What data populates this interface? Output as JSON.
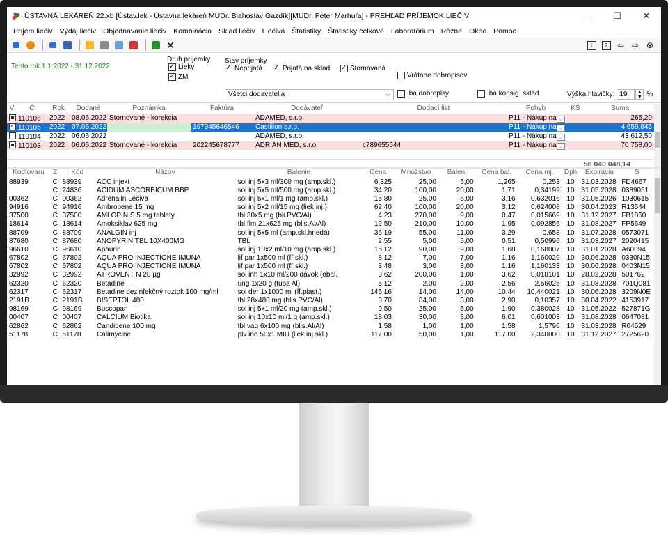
{
  "window": {
    "title": "ÚSTAVNÁ LEKÁREŇ 22.xb [Ústav.lek - Ústavna lekáreň MUDr. Blahoslav Gazdík][MUDr. Peter Marhuľa] - PREHĽAD PRÍJEMOK LIEČIV",
    "minimize": "—",
    "maximize": "☐",
    "close": "✕"
  },
  "menu": [
    "Príjem liečiv",
    "Výdaj liečiv",
    "Objednávanie liečiv",
    "Kombinácia",
    "Sklad liečiv",
    "Liečivá",
    "Štatistiky",
    "Štatistiky celkové",
    "Laboratórium",
    "Rôzne",
    "Okno",
    "Pomoc"
  ],
  "toolbar": {
    "close_glyph": "✕",
    "right_glyphs": [
      "i",
      "?",
      "⇦",
      "⇨",
      "⊗"
    ]
  },
  "filters": {
    "period": "Tento rok  1.1.2022 - 31.12.2022",
    "druh_title": "Druh príjemky",
    "druh_lieky": "Lieky",
    "druh_zm": "ZM",
    "stav_title": "Stav príjemky",
    "stav_neprijata": "Neprijatá",
    "stav_prijata": "Prijatá na sklad",
    "stav_stornovana": "Stornovaná",
    "vratane": "Vrátane dobropisov",
    "iba_dobropisy": "Iba dobropisy",
    "iba_konsig": "Iba konsig. sklad",
    "dodavatel_select": "Všetci dodavatelia",
    "vyska_label": "Výška hlavičky:",
    "vyska_value": "19",
    "vyska_unit": "%"
  },
  "upper_table": {
    "headers": [
      "V",
      "Č",
      "Rok",
      "Dodané",
      "Poznámka",
      "Faktúra",
      "Dodávateľ",
      "Dodací list",
      "Pohyb",
      "KS",
      "Suma"
    ],
    "rows": [
      {
        "c": "110106",
        "rok": "2022",
        "dodane": "08.06.2022",
        "poznamka": "Stornované - korekcia",
        "faktura": "",
        "dodavatel": "ADAMED, s.r.o.",
        "dodaci": "",
        "pohyb": "P11 - Nákup na",
        "ks": "",
        "suma": "265,20",
        "style": "pink",
        "mark": "fill"
      },
      {
        "c": "110105",
        "rok": "2022",
        "dodane": "07.06.2022",
        "poznamka": "",
        "faktura": "197945646546",
        "dodavatel": "Castilion s.r.o.",
        "dodaci": "",
        "pohyb": "P11 - Nákup na",
        "ks": "",
        "suma": "4 659,845",
        "style": "sel",
        "mark": "check"
      },
      {
        "c": "110104",
        "rok": "2022",
        "dodane": "06.06.2022",
        "poznamka": "",
        "faktura": "",
        "dodavatel": "ADAMED, s.r.o.",
        "dodaci": "",
        "pohyb": "P11 - Nákup na",
        "ks": "",
        "suma": "43 612,50",
        "style": "white",
        "mark": "empty"
      },
      {
        "c": "110103",
        "rok": "2022",
        "dodane": "06.06.2022",
        "poznamka": "Stornované - korekcia",
        "faktura": "202245678777",
        "dodavatel": "ADRIAN MED, s.r.o.",
        "dodaci": "c789655544",
        "pohyb": "P11 - Nákup na",
        "ks": "",
        "suma": "70 758,00",
        "style": "pink",
        "mark": "fill"
      }
    ],
    "total": "56 040 048,14"
  },
  "lower_table": {
    "headers": [
      "Kodtovaru",
      "Z",
      "Kód",
      "Názov",
      "Balenie",
      "Cena",
      "Množstvo",
      "Balení",
      "Cena bal.",
      "Cena mj.",
      "Dph",
      "Expirácia",
      "Š"
    ],
    "rows": [
      [
        "88939",
        "C",
        "88939",
        "ACC injekt",
        "sol inj 5x3 ml/300 mg (amp.skl.)",
        "6,325",
        "25,00",
        "5,00",
        "1,265",
        "0,253",
        "10",
        "31.03.2028",
        "FD4667"
      ],
      [
        "",
        "C",
        "24836",
        "ACIDUM ASCORBICUM BBP",
        "sol inj 5x5 ml/500 mg (amp.skl.)",
        "34,20",
        "100,00",
        "20,00",
        "1,71",
        "0,34199",
        "10",
        "31.05.2028",
        "0389051"
      ],
      [
        "00362",
        "C",
        "00362",
        "Adrenalin Léčiva",
        "sol inj 5x1 ml/1 mg (amp.skl.)",
        "15,80",
        "25,00",
        "5,00",
        "3,16",
        "0,632016",
        "10",
        "31.05.2026",
        "1030615"
      ],
      [
        "94916",
        "C",
        "94916",
        "Ambrobene 15 mg",
        "sol inj 5x2 ml/15 mg (liek.inj.)",
        "62,40",
        "100,00",
        "20,00",
        "3,12",
        "0,624008",
        "10",
        "30.04.2023",
        "R13544"
      ],
      [
        "37500",
        "C",
        "37500",
        "AMLOPIN S 5 mg tablety",
        "tbl 30x5 mg (bli.PVC/Al)",
        "4,23",
        "270,00",
        "9,00",
        "0,47",
        "0,015669",
        "10",
        "31.12.2027",
        "FB1860"
      ],
      [
        "18614",
        "C",
        "18614",
        "Amoksiklav 625 mg",
        "tbl flm 21x625 mg (blis.Al/Al)",
        "19,50",
        "210,00",
        "10,00",
        "1,95",
        "0,092856",
        "10",
        "31.08.2027",
        "FP5649"
      ],
      [
        "88709",
        "C",
        "88709",
        "ANALGIN inj",
        "sol inj 5x5 ml (amp.skl.hnedá)",
        "36,19",
        "55,00",
        "11,00",
        "3,29",
        "0,658",
        "10",
        "31.07.2028",
        "0573071"
      ],
      [
        "87680",
        "C",
        "87680",
        "ANOPYRIN  TBL 10X400MG",
        "TBL",
        "2,55",
        "5,00",
        "5,00",
        "0,51",
        "0,50996",
        "10",
        "31.03.2027",
        "2020415"
      ],
      [
        "96610",
        "C",
        "96610",
        "Apaurin",
        "sol inj 10x2 ml/10 mg (amp.skl.)",
        "15,12",
        "90,00",
        "9,00",
        "1,68",
        "0,168007",
        "10",
        "31.01.2028",
        "A60094"
      ],
      [
        "67802",
        "C",
        "67802",
        "AQUA PRO INJECTIONE IMUNA",
        "lif par 1x500 ml (fľ.skl.)",
        "8,12",
        "7,00",
        "7,00",
        "1,16",
        "1,160029",
        "10",
        "30.06.2028",
        "0330N15"
      ],
      [
        "67802",
        "C",
        "67802",
        "AQUA PRO INJECTIONE IMUNA",
        "lif par 1x500 ml (fľ.skl.)",
        "3,48",
        "3,00",
        "3,00",
        "1,16",
        "1,160133",
        "10",
        "30.06.2028",
        "0403N15"
      ],
      [
        "32992",
        "C",
        "32992",
        "ATROVENT N 20 µg",
        "sol inh 1x10 ml/200 dávok (obal.",
        "3,62",
        "200,00",
        "1,00",
        "3,62",
        "0,018101",
        "10",
        "28.02.2028",
        "501762"
      ],
      [
        "62320",
        "C",
        "62320",
        "Betadine",
        "ung 1x20 g (tuba Al)",
        "5,12",
        "2,00",
        "2,00",
        "2,56",
        "2,56025",
        "10",
        "31.08.2028",
        "701Q081"
      ],
      [
        "62317",
        "C",
        "62317",
        "Betadine dezinfekčný roztok 100 mg/ml",
        "sol der 1x1000 ml (fľ.plast.)",
        "146,16",
        "14,00",
        "14,00",
        "10,44",
        "10,440021",
        "10",
        "30.06.2028",
        "3209N0E"
      ],
      [
        "2191B",
        "C",
        "2191B",
        "BISEPTOL 480",
        "tbl 28x480 mg (blis.PVC/Al)",
        "8,70",
        "84,00",
        "3,00",
        "2,90",
        "0,10357",
        "10",
        "30.04.2022",
        "4153917"
      ],
      [
        "98169",
        "C",
        "98169",
        "Buscopan",
        "sol inj 5x1 ml/20 mg (amp.skl.)",
        "9,50",
        "25,00",
        "5,00",
        "1,90",
        "0,380028",
        "10",
        "31.05.2022",
        "527871G"
      ],
      [
        "00407",
        "C",
        "00407",
        "CALCIUM Biotika",
        "sol inj 10x10 ml/1 g (amp.skl.)",
        "18,03",
        "30,00",
        "3,00",
        "6,01",
        "0,601003",
        "10",
        "31.08.2028",
        "0647081"
      ],
      [
        "62862",
        "C",
        "62862",
        "Candibene 100 mg",
        "tbl vag 6x100 mg (blis.Al/Al)",
        "1,58",
        "1,00",
        "1,00",
        "1,58",
        "1,5796",
        "10",
        "31.03.2028",
        "R04529"
      ],
      [
        "51178",
        "C",
        "51178",
        "Calimycine",
        "plv ino 50x1 MIU (liek.inj.skl.)",
        "117,00",
        "50,00",
        "1,00",
        "117,00",
        "2,340000",
        "10",
        "31.12.2027",
        "2725620"
      ]
    ]
  }
}
